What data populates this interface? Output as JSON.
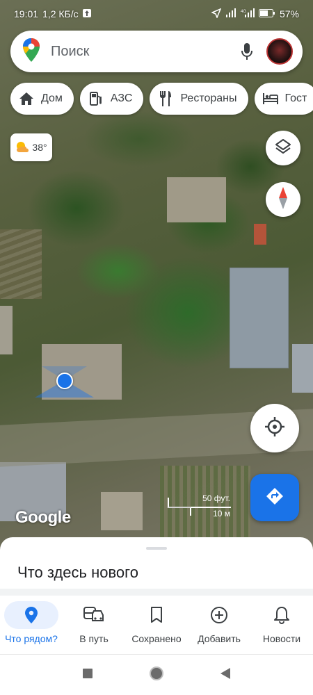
{
  "status": {
    "time": "19:01",
    "network_speed": "1,2 КБ/с",
    "battery": "57%",
    "icons": [
      "upload-icon",
      "location-arrow-icon",
      "signal-icon",
      "4g-signal-icon",
      "battery-icon"
    ]
  },
  "search": {
    "placeholder": "Поиск",
    "icons": [
      "maps-pin-logo-icon",
      "mic-icon",
      "avatar"
    ]
  },
  "chips": [
    {
      "label": "Дом",
      "icon": "home-icon"
    },
    {
      "label": "АЗС",
      "icon": "gas-station-icon"
    },
    {
      "label": "Рестораны",
      "icon": "restaurant-icon"
    },
    {
      "label": "Гост",
      "icon": "hotel-icon"
    }
  ],
  "weather": {
    "temperature": "38°",
    "icon": "partly-sunny-icon"
  },
  "map": {
    "scale_feet": "50 фут.",
    "scale_meters": "10 м",
    "logo": "Google"
  },
  "bottom_sheet": {
    "title": "Что здесь нового"
  },
  "bottom_nav": [
    {
      "label": "Что рядом?",
      "icon": "place-pin-icon",
      "active": true
    },
    {
      "label": "В путь",
      "icon": "commute-icon",
      "active": false
    },
    {
      "label": "Сохранено",
      "icon": "bookmark-icon",
      "active": false
    },
    {
      "label": "Добавить",
      "icon": "add-circle-icon",
      "active": false
    },
    {
      "label": "Новости",
      "icon": "bell-icon",
      "active": false
    }
  ],
  "colors": {
    "accent": "#1a73e8",
    "active_bg": "#e8f0fe",
    "text": "#3c4043"
  }
}
